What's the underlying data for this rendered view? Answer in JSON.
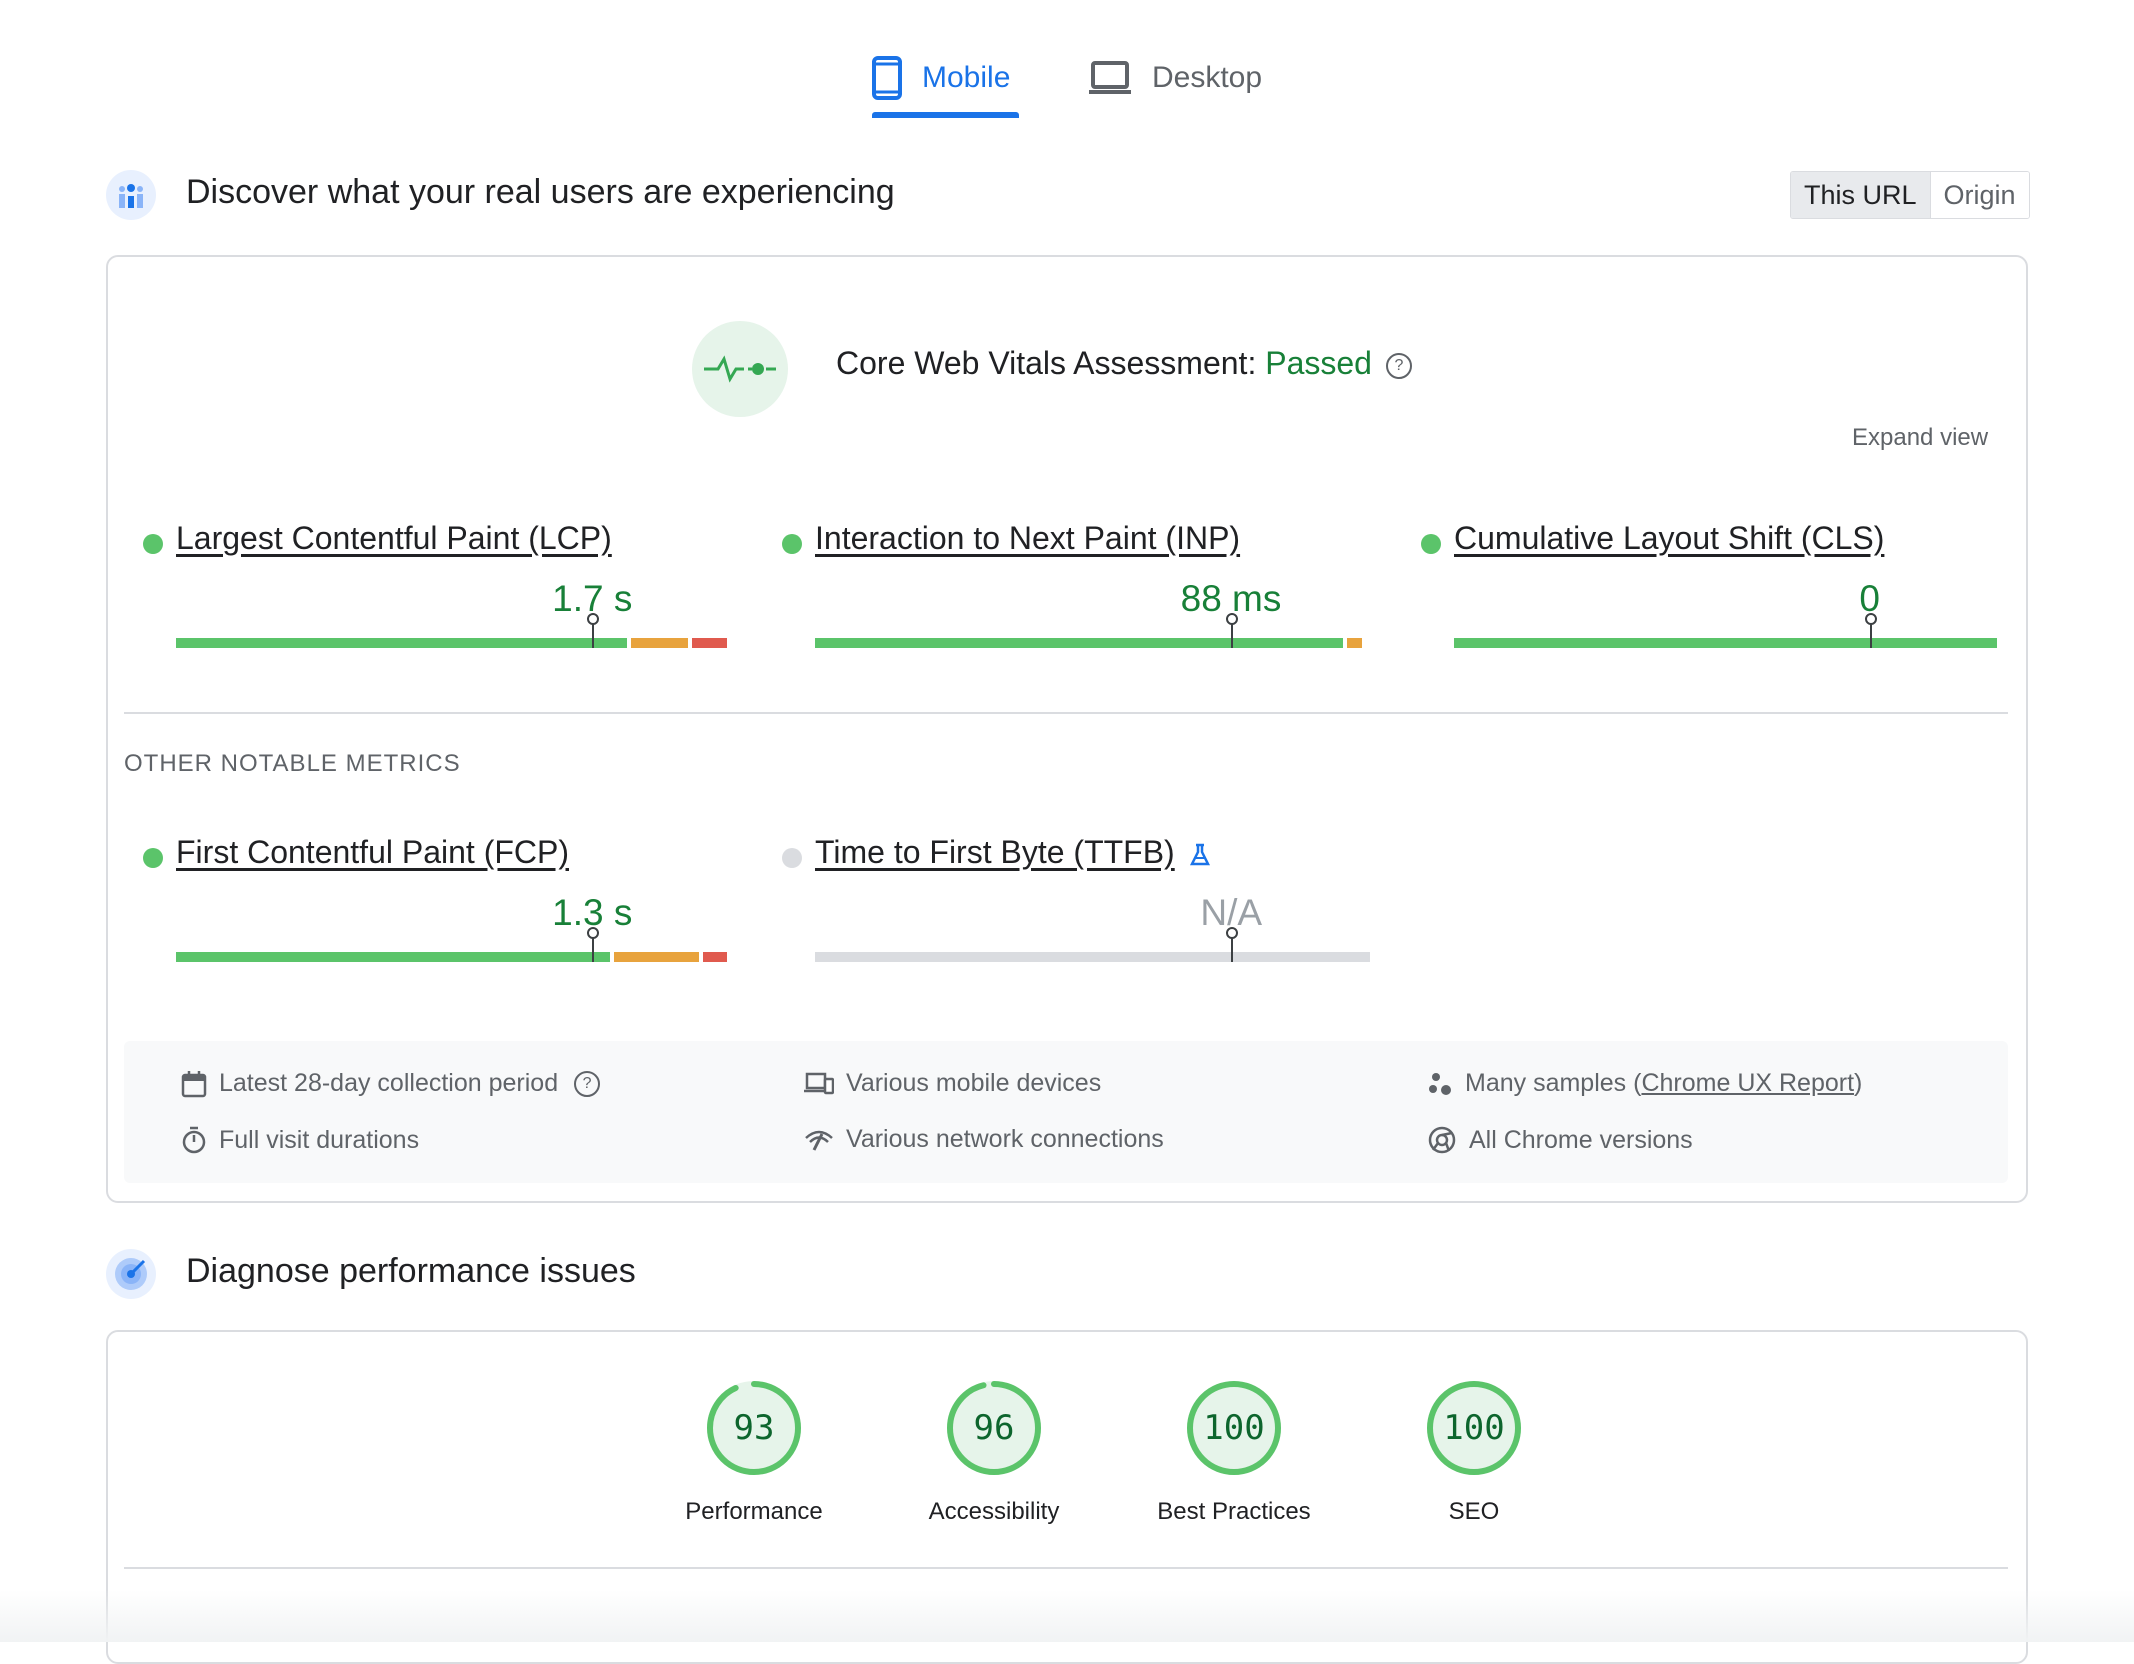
{
  "tabs": {
    "mobile": "Mobile",
    "desktop": "Desktop"
  },
  "field": {
    "title": "Discover what your real users are experiencing",
    "toggle": {
      "this_url": "This URL",
      "origin": "Origin"
    },
    "assessment": {
      "label": "Core Web Vitals Assessment: ",
      "status": "Passed",
      "help_icon": "help-icon"
    },
    "expand_view": "Expand view",
    "core_metrics": [
      {
        "name": "Largest Contentful Paint (LCP)",
        "value": "1.7 s",
        "status": "good",
        "distribution": {
          "good": 0.82,
          "needs_improvement": 0.11,
          "poor": 0.07
        },
        "marker": 0.75
      },
      {
        "name": "Interaction to Next Paint (INP)",
        "value": "88 ms",
        "status": "good",
        "distribution": {
          "good": 0.965,
          "needs_improvement": 0.035,
          "poor": 0.0
        },
        "marker": 0.755
      },
      {
        "name": "Cumulative Layout Shift (CLS)",
        "value": "0",
        "status": "good",
        "distribution": {
          "good": 1.0,
          "needs_improvement": 0.0,
          "poor": 0.0
        },
        "marker": 0.76
      }
    ],
    "other_label": "OTHER NOTABLE METRICS",
    "other_metrics": [
      {
        "name": "First Contentful Paint (FCP)",
        "value": "1.3 s",
        "status": "good",
        "distribution": {
          "good": 0.79,
          "needs_improvement": 0.16,
          "poor": 0.05
        },
        "marker": 0.75
      },
      {
        "name": "Time to First Byte (TTFB)",
        "value": "N/A",
        "status": "none",
        "experimental_icon": "flask-icon",
        "distribution": {
          "good": 0,
          "needs_improvement": 0,
          "poor": 0
        },
        "marker": 0.75
      }
    ],
    "info": {
      "period": "Latest 28-day collection period",
      "durations": "Full visit durations",
      "devices": "Various mobile devices",
      "network": "Various network connections",
      "samples_prefix": "Many samples (",
      "samples_link": "Chrome UX Report",
      "samples_suffix": ")",
      "versions": "All Chrome versions"
    }
  },
  "lab": {
    "title": "Diagnose performance issues",
    "scores": [
      {
        "label": "Performance",
        "score": "93"
      },
      {
        "label": "Accessibility",
        "score": "96"
      },
      {
        "label": "Best Practices",
        "score": "100"
      },
      {
        "label": "SEO",
        "score": "100"
      }
    ]
  },
  "colors": {
    "accent": "#1a73e8",
    "good": "#5bc46a",
    "needs_improvement": "#e8a33d",
    "poor": "#e05a4e",
    "neutral": "#dadce0",
    "pass_text": "#188038"
  }
}
